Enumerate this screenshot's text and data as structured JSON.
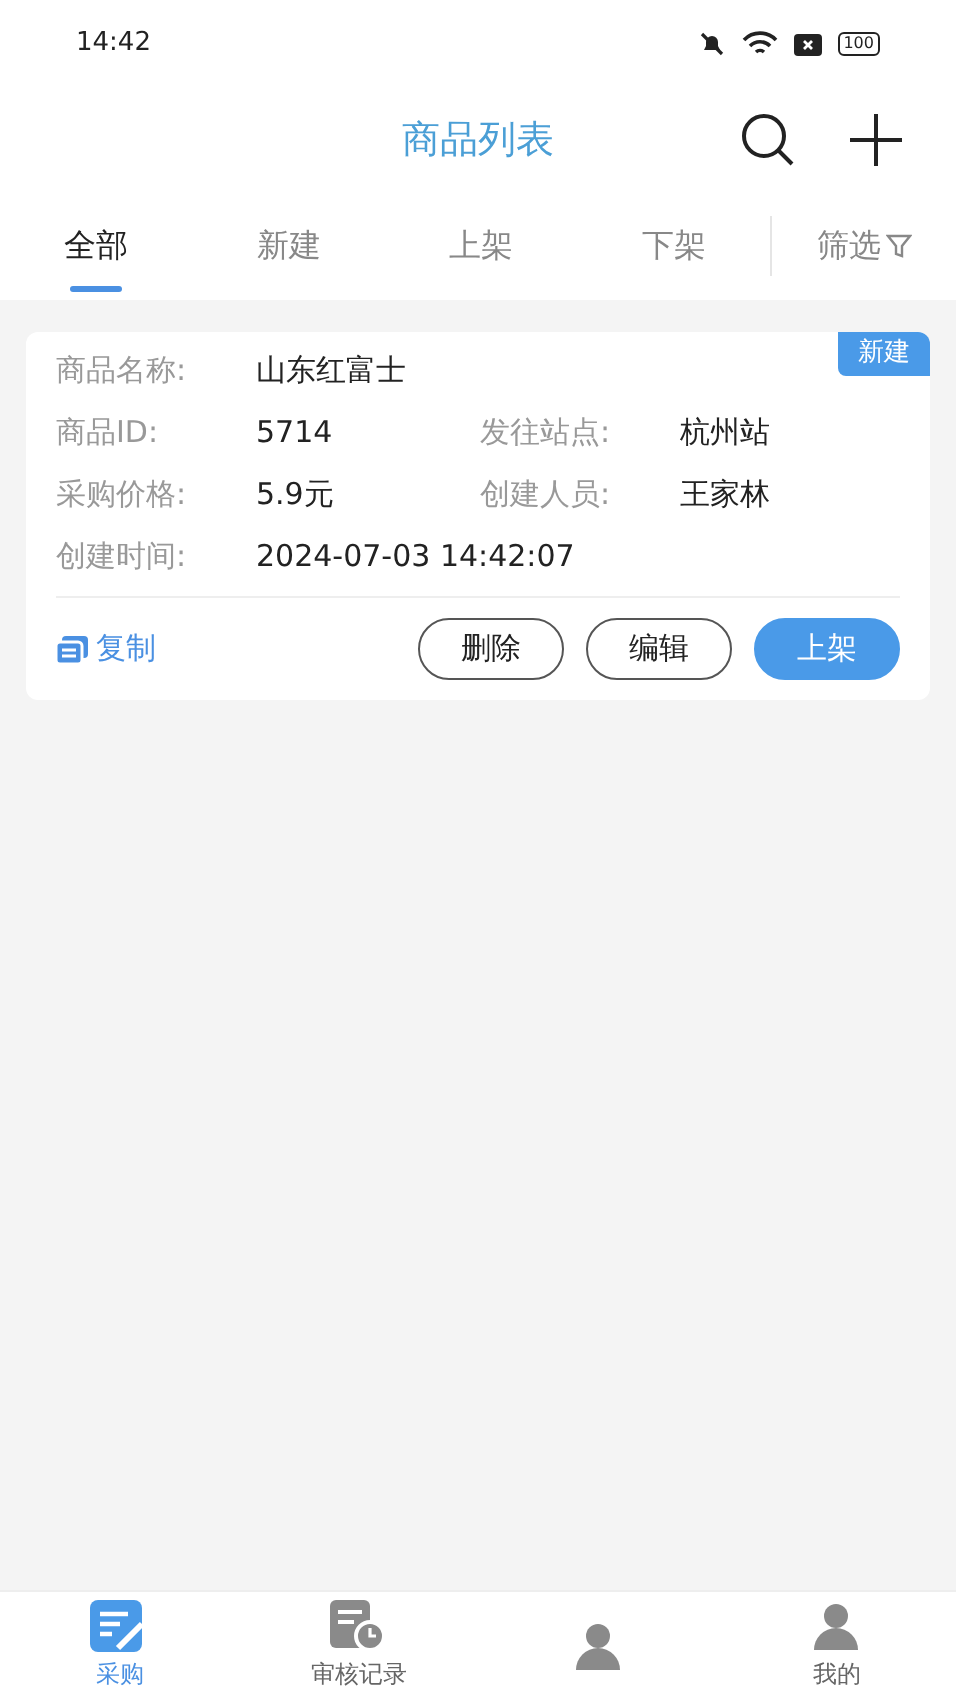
{
  "status_bar": {
    "time": "14:42",
    "battery": "100"
  },
  "header": {
    "title": "商品列表"
  },
  "tabs": [
    {
      "label": "全部",
      "selected": true
    },
    {
      "label": "新建",
      "selected": false
    },
    {
      "label": "上架",
      "selected": false
    },
    {
      "label": "下架",
      "selected": false
    }
  ],
  "filter": {
    "label": "筛选"
  },
  "products": [
    {
      "status": "新建",
      "fields": [
        {
          "label": "商品名称:",
          "value": "山东红富士"
        },
        {
          "label": "商品ID:",
          "value": "5714"
        },
        {
          "label": "发往站点:",
          "value": "杭州站"
        },
        {
          "label": "采购价格:",
          "value": "5.9元"
        },
        {
          "label": "创建人员:",
          "value": "王家林"
        },
        {
          "label": "创建时间:",
          "value": "2024-07-03 14:42:07"
        }
      ],
      "copy": "复制",
      "buttons": [
        {
          "label": "删除",
          "kind": "outline"
        },
        {
          "label": "编辑",
          "kind": "outline"
        },
        {
          "label": "上架",
          "kind": "primary"
        }
      ]
    }
  ],
  "bottom_nav": [
    {
      "label": "采购",
      "selected": true,
      "kind": "purchase"
    },
    {
      "label": "审核记录",
      "selected": false,
      "kind": "review"
    },
    {
      "selected": false,
      "kind": "other"
    },
    {
      "label": "我的",
      "selected": false,
      "kind": "me"
    }
  ]
}
